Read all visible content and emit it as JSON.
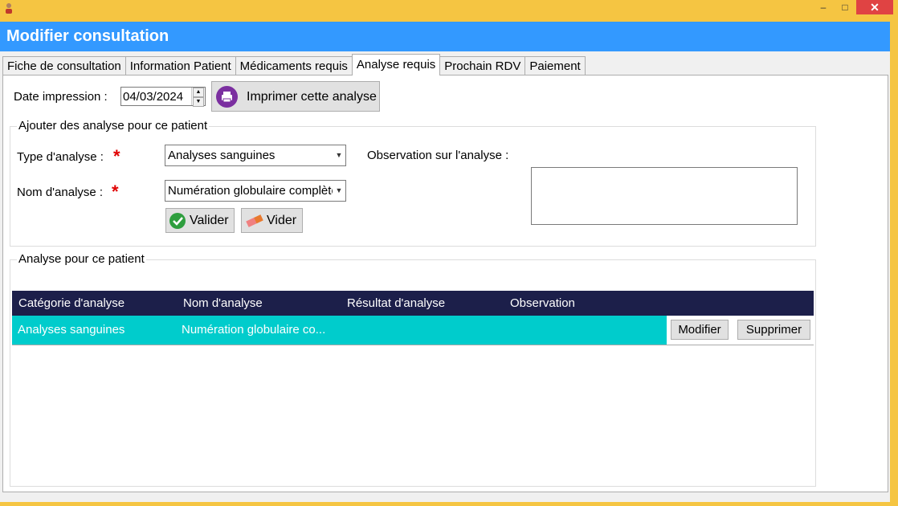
{
  "window": {
    "title": "Modifier consultation",
    "controls": {
      "minimize": "–",
      "maximize": "□",
      "close": "✕"
    }
  },
  "tabs": [
    {
      "label": "Fiche de consultation",
      "active": false
    },
    {
      "label": "Information Patient",
      "active": false
    },
    {
      "label": "Médicaments requis",
      "active": false
    },
    {
      "label": "Analyse requis",
      "active": true
    },
    {
      "label": "Prochain RDV",
      "active": false
    },
    {
      "label": "Paiement",
      "active": false
    }
  ],
  "print": {
    "date_label": "Date impression :",
    "date_value": "04/03/2024",
    "print_button": "Imprimer cette analyse",
    "print_icon": "printer-icon"
  },
  "add_group": {
    "title": "Ajouter des analyse pour ce patient",
    "type_label": "Type d'analyse :",
    "type_value": "Analyses sanguines",
    "name_label": "Nom d'analyse :",
    "name_value": "Numération globulaire complète",
    "required_mark": "*",
    "observation_label": "Observation sur l'analyse :",
    "observation_value": "",
    "validate_button": "Valider",
    "clear_button": "Vider",
    "validate_icon": "check-icon",
    "clear_icon": "eraser-icon"
  },
  "list_group": {
    "title": "Analyse pour ce patient",
    "columns": [
      "Catégorie d'analyse",
      "Nom d'analyse",
      "Résultat d'analyse",
      "Observation"
    ],
    "rows": [
      {
        "category": "Analyses sanguines",
        "name": "Numération globulaire co...",
        "result": "",
        "observation": "",
        "edit_button": "Modifier",
        "delete_button": "Supprimer"
      }
    ]
  },
  "colors": {
    "header": "#3399ff",
    "grid_header": "#1c1f4a",
    "row_highlight": "#00cccc",
    "frame": "#f5c542",
    "close_button": "#e04343",
    "print_icon_bg": "#7b2fa0"
  }
}
